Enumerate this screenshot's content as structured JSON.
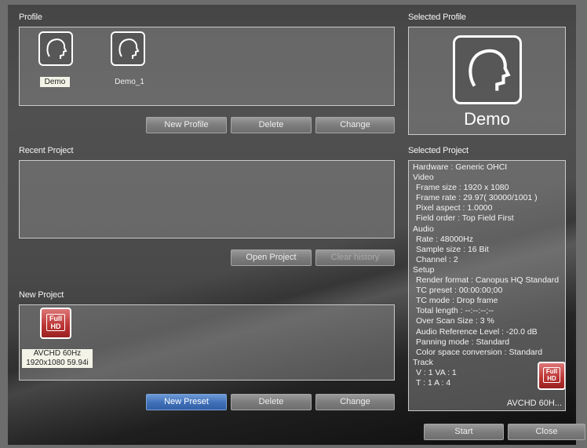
{
  "profile": {
    "section_label": "Profile",
    "items": [
      {
        "name": "Demo",
        "selected": true
      },
      {
        "name": "Demo_1",
        "selected": false
      }
    ],
    "buttons": {
      "new_profile": "New Profile",
      "delete": "Delete",
      "change": "Change"
    }
  },
  "selected_profile": {
    "section_label": "Selected Profile",
    "name": "Demo"
  },
  "recent_project": {
    "section_label": "Recent Project",
    "buttons": {
      "open_project": "Open Project",
      "clear_history": "Clear history"
    }
  },
  "new_project": {
    "section_label": "New Project",
    "preset": {
      "badge_line1": "Full",
      "badge_line2": "HD",
      "name": "AVCHD 60Hz",
      "detail": "1920x1080 59.94i"
    },
    "buttons": {
      "new_preset": "New Preset",
      "delete": "Delete",
      "change": "Change"
    }
  },
  "selected_project": {
    "section_label": "Selected Project",
    "lines": [
      {
        "text": "Hardware : Generic OHCI",
        "indent": false
      },
      {
        "text": "Video",
        "indent": false
      },
      {
        "text": "Frame size : 1920 x 1080",
        "indent": true
      },
      {
        "text": "Frame rate : 29.97( 30000/1001 )",
        "indent": true
      },
      {
        "text": "Pixel aspect : 1.0000",
        "indent": true
      },
      {
        "text": "Field order : Top Field First",
        "indent": true
      },
      {
        "text": "Audio",
        "indent": false
      },
      {
        "text": "Rate : 48000Hz",
        "indent": true
      },
      {
        "text": "Sample size : 16 Bit",
        "indent": true
      },
      {
        "text": "Channel : 2",
        "indent": true
      },
      {
        "text": "Setup",
        "indent": false
      },
      {
        "text": "Render format : Canopus HQ Standard",
        "indent": true
      },
      {
        "text": "TC preset : 00:00:00;00",
        "indent": true
      },
      {
        "text": "TC mode : Drop frame",
        "indent": true
      },
      {
        "text": "Total length : --:--:--;--",
        "indent": true
      },
      {
        "text": "Over Scan Size : 3 %",
        "indent": true
      },
      {
        "text": "Audio Reference Level : -20.0 dB",
        "indent": true
      },
      {
        "text": "Panning mode : Standard",
        "indent": true
      },
      {
        "text": "Color space conversion : Standard",
        "indent": true
      },
      {
        "text": "Track",
        "indent": false
      },
      {
        "text": "V : 1  VA : 1",
        "indent": true
      },
      {
        "text": "T : 1  A : 4",
        "indent": true
      }
    ],
    "badge_line1": "Full",
    "badge_line2": "HD",
    "preset_name": "AVCHD 60H..."
  },
  "footer": {
    "start": "Start",
    "close": "Close"
  },
  "colors": {
    "accent_blue": "#3f6fb8",
    "hd_red": "#b33333"
  }
}
